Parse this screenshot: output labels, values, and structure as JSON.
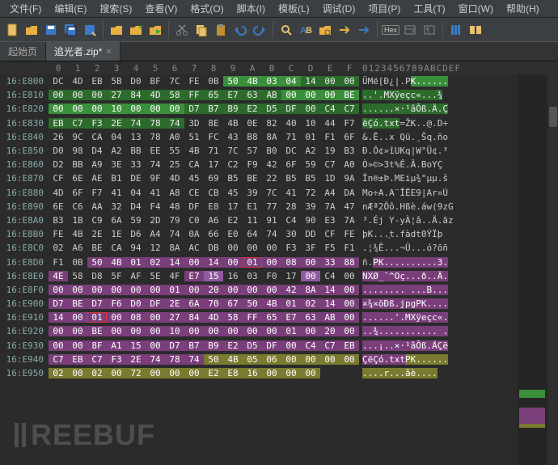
{
  "menubar": [
    "文件(F)",
    "编辑(E)",
    "搜索(S)",
    "查看(V)",
    "格式(O)",
    "脚本(I)",
    "模板(L)",
    "调试(D)",
    "项目(P)",
    "工具(T)",
    "窗口(W)",
    "帮助(H)"
  ],
  "toolbar": {
    "hex_label": "Hex"
  },
  "tabs": [
    {
      "label": "起始页",
      "active": false
    },
    {
      "label": "追光者.zip*",
      "active": true,
      "closable": true
    }
  ],
  "hex": {
    "offset_header_cols": [
      "0",
      "1",
      "2",
      "3",
      "4",
      "5",
      "6",
      "7",
      "8",
      "9",
      "A",
      "B",
      "C",
      "D",
      "E",
      "F"
    ],
    "ascii_header": "0123456789ABCDEF",
    "rows": [
      {
        "addr": "16:E800",
        "bytes": "DC 4D EB 5B D0 BF 7C FE 0B 50 4B 03 04 14 00 00",
        "ascii": "ÜMë[Ð¿|.PK......",
        "hl": {
          "g": [
            9,
            10,
            11,
            12
          ],
          "gd": [
            13,
            14,
            15
          ]
        },
        "asc_hl": {
          "g": [
            9,
            16
          ]
        }
      },
      {
        "addr": "16:E810",
        "bytes": "00 00 00 27 84 4D 58 FF 65 E7 63 AB 00 00 00 BE",
        "ascii": "..'.MXÿeçc«...¾",
        "hl": {
          "gd": [
            0,
            1,
            2,
            3,
            4,
            5,
            6,
            7,
            8,
            9,
            10,
            11
          ],
          "g": [
            12,
            13,
            14,
            15
          ]
        },
        "asc_hl": {
          "gd": [
            0,
            16
          ]
        }
      },
      {
        "addr": "16:E820",
        "bytes": "00 00 00 10 00 00 00 D7 B7 B9 E2 D5 DF 00 C4 C7",
        "ascii": "......×·¹âÕß.Ä.Ç",
        "hl": {
          "g": [
            0,
            1,
            2,
            3,
            4,
            5,
            6
          ],
          "gd": [
            7,
            8,
            9,
            10,
            11,
            12,
            13,
            14,
            15
          ]
        },
        "asc_hl": {
          "gd": [
            0,
            16
          ]
        }
      },
      {
        "addr": "16:E830",
        "bytes": "EB C7 F3 2E 74 78 74 3D 8E 4B 0E 82 40 10 44 F7",
        "ascii": "ëÇó.txt=ŽK..@.D÷",
        "hl": {
          "gd": [
            0,
            1,
            2,
            3,
            4,
            5,
            6
          ]
        },
        "asc_hl": {
          "gd": [
            0,
            7
          ]
        }
      },
      {
        "addr": "16:E840",
        "bytes": "26 9C CA 04 13 78 A0 51 FC 43 B8 8A 71 01 F1 6F",
        "ascii": "&.Ê..x Qü.¸Šq.ño",
        "hl": {}
      },
      {
        "addr": "16:E850",
        "bytes": "D0 98 D4 A2 BB EE 55 4B 71 7C 57 B0 DC A2 19 B3",
        "ascii": "Ð.Ô¢»îUKq|W°Ü¢.³",
        "hl": {}
      },
      {
        "addr": "16:E860",
        "bytes": "D2 BB A9 3E 33 74 25 CA 17 C2 F9 42 6F 59 C7 A0",
        "ascii": "Ò»©>3t%Ê.Â.BoYÇ ",
        "hl": {}
      },
      {
        "addr": "16:E870",
        "bytes": "CF 6E AE B1 DE 9F 4D 45 69 B5 BE 22 B5 B5 1D 9A",
        "ascii": "Ïn®±Þ.MEiµ¾\"µµ.š",
        "hl": {}
      },
      {
        "addr": "16:E880",
        "bytes": "4D 6F F7 41 04 41 A8 CE CB 45 39 7C 41 72 A4 DA",
        "ascii": "Mo÷A.A¨ÎËE9|Ar¤Ú",
        "hl": {}
      },
      {
        "addr": "16:E890",
        "bytes": "6E C6 AA 32 D4 F4 48 DF E8 17 E1 77 28 39 7A 47",
        "ascii": "nÆª2Ôô.Hßè.áw(9zG",
        "hl": {}
      },
      {
        "addr": "16:E8A0",
        "bytes": "B3 1B C9 6A 59 2D 79 C0 A6 E2 11 91 C4 90 E3 7A",
        "ascii": "³.Éj Y-yÀ¦â..Ä.ãz",
        "hl": {}
      },
      {
        "addr": "16:E8B0",
        "bytes": "FE 4B 2E 1E D6 A4 74 0A 66 E0 64 74 30 DD CF FE",
        "ascii": "þK...֤t.fàdt0ÝÏþ",
        "hl": {}
      },
      {
        "addr": "16:E8C0",
        "bytes": "02 A6 BE CA 94 12 8A AC DB 00 00 00 F3 3F F5 F1",
        "ascii": ".¦¾Ê...¬Û...ó?õñ",
        "hl": {}
      },
      {
        "addr": "16:E8D0",
        "bytes": "F1 0B 50 4B 01 02 14 00 14 00 01 00 08 00 33 88",
        "ascii": "ñ.PK..........3.",
        "hl": {
          "p": [
            2,
            3,
            4,
            5,
            6,
            7,
            8,
            9,
            10,
            11,
            12,
            13,
            14,
            15
          ],
          "rO": [
            10
          ]
        },
        "asc_hl": {
          "p": [
            2,
            16
          ]
        }
      },
      {
        "addr": "16:E8E0",
        "bytes": "4E 58 D8 5F AF 5E 4F E7 15 16 03 F0 17 00 C4 00",
        "ascii": "NXØ_¯^Oç...ð..Ä.",
        "hl": {
          "p": [
            0,
            7
          ],
          "pl": [
            8,
            13
          ]
        },
        "asc_hl": {
          "p": [
            0,
            16
          ]
        }
      },
      {
        "addr": "16:E8F0",
        "bytes": "00 00 00 00 00 00 01 00 20 00 00 00 42 8A 14 00",
        "ascii": "........ ...B...",
        "hl": {
          "p": [
            0,
            1,
            2,
            3,
            4,
            5,
            6,
            7,
            8,
            9,
            10,
            11,
            12,
            13,
            14,
            15
          ]
        },
        "asc_hl": {
          "p": [
            0,
            16
          ]
        }
      },
      {
        "addr": "16:E900",
        "bytes": "D7 BE D7 F6 D0 DF 2E 6A 70 67 50 4B 01 02 14 00",
        "ascii": "×¾×öÐß.jpgPK....",
        "hl": {
          "p": [
            0,
            1,
            2,
            3,
            4,
            5,
            6,
            7,
            8,
            9,
            10,
            11,
            12,
            13,
            14,
            15
          ]
        },
        "asc_hl": {
          "p": [
            0,
            16
          ]
        }
      },
      {
        "addr": "16:E910",
        "bytes": "14 00 01 00 08 00 27 84 4D 58 FF 65 E7 63 AB 00",
        "ascii": "......'.MXÿeçc«.",
        "hl": {
          "p": [
            0,
            1,
            2,
            3,
            4,
            5,
            6,
            7,
            8,
            9,
            10,
            11,
            12,
            13,
            14,
            15
          ],
          "rO": [
            2
          ]
        },
        "asc_hl": {
          "p": [
            0,
            16
          ]
        }
      },
      {
        "addr": "16:E920",
        "bytes": "00 00 BE 00 00 00 10 00 00 00 00 00 01 00 20 00",
        "ascii": "..¾........... .",
        "hl": {
          "p": [
            0,
            1,
            2,
            3,
            4,
            5,
            6,
            7,
            8,
            9,
            10,
            11,
            12,
            13,
            14,
            15
          ]
        },
        "asc_hl": {
          "p": [
            0,
            16
          ]
        }
      },
      {
        "addr": "16:E930",
        "bytes": "00 00 8F A1 15 00 D7 B7 B9 E2 D5 DF 00 C4 C7 EB",
        "ascii": "...¡..×·¹âÕß.ÄÇë",
        "hl": {
          "p": [
            0,
            1,
            2,
            3,
            4,
            5,
            6,
            7,
            8,
            9,
            10,
            11,
            12,
            13,
            14,
            15
          ]
        },
        "asc_hl": {
          "p": [
            0,
            16
          ]
        }
      },
      {
        "addr": "16:E940",
        "bytes": "C7 EB C7 F3 2E 74 78 74 50 4B 05 06 00 00 00 00",
        "ascii": "ÇëÇó.txtPK......",
        "hl": {
          "p": [
            0,
            1,
            2,
            3,
            4,
            5,
            6,
            7
          ],
          "o": [
            8,
            9,
            10,
            11,
            12,
            13,
            14,
            15
          ]
        },
        "asc_hl": {
          "p": [
            0,
            8
          ],
          "o": [
            8,
            16
          ]
        }
      },
      {
        "addr": "16:E950",
        "bytes": "02 00 02 00 72 00 00 00 E2 E8 16 00 00 00",
        "ascii": "....r...âè....",
        "hl": {
          "o": [
            0,
            1,
            2,
            3,
            4,
            5,
            6,
            7,
            8,
            9,
            10,
            11,
            12,
            13
          ]
        },
        "asc_hl": {
          "o": [
            0,
            14
          ]
        }
      }
    ]
  },
  "watermark": "REEBUF"
}
